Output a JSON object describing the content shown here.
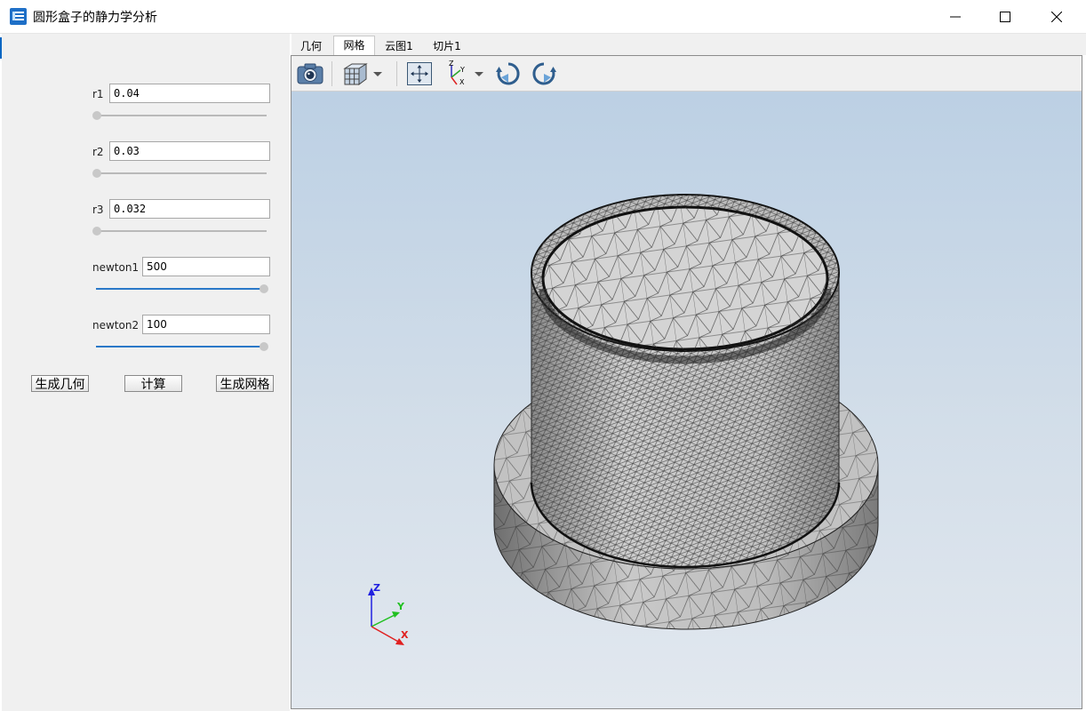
{
  "window": {
    "title": "圆形盒子的静力学分析",
    "controls": [
      "minimize-icon",
      "maximize-icon",
      "close-icon"
    ]
  },
  "parameters": [
    {
      "label": "r1",
      "value": "0.04",
      "slider": 0.0
    },
    {
      "label": "r2",
      "value": "0.03",
      "slider": 0.0
    },
    {
      "label": "r3",
      "value": "0.032",
      "slider": 0.0
    },
    {
      "label": "newton1",
      "value": "500",
      "slider": 1.0
    },
    {
      "label": "newton2",
      "value": "100",
      "slider": 1.0
    }
  ],
  "buttons": {
    "generate_geometry": "生成几何",
    "compute": "计算",
    "generate_mesh": "生成网格"
  },
  "tabs": [
    {
      "label": "几何",
      "active": false
    },
    {
      "label": "网格",
      "active": true
    },
    {
      "label": "云图1",
      "active": false
    },
    {
      "label": "切片1",
      "active": false
    }
  ],
  "toolbar": {
    "icons": [
      "camera-icon",
      "view-cube-icon",
      "dropdown-arrow-icon",
      "fit-all-icon",
      "axis-orientation-icon",
      "dropdown-arrow-icon",
      "rotate-ccw-icon",
      "rotate-cw-icon"
    ]
  },
  "axis_triad": {
    "x": "X",
    "y": "Y",
    "z": "Z"
  },
  "colors": {
    "slider_fill": "#2a78c8",
    "viewport_top": "#bcd0e4",
    "viewport_bottom": "#e2e8ef",
    "axis_x": "#e02020",
    "axis_y": "#20c020",
    "axis_z": "#2020e0"
  }
}
